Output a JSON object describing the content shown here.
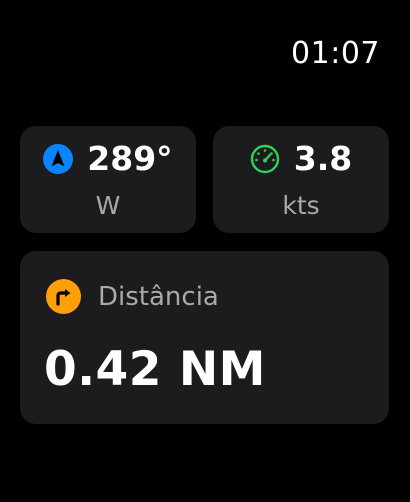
{
  "status_bar": {
    "time": "01:07"
  },
  "heading_card": {
    "icon": "navigation-arrow-icon",
    "icon_color": "#0a84ff",
    "value": "289°",
    "direction": "W"
  },
  "speed_card": {
    "icon": "speedometer-icon",
    "icon_color": "#30d158",
    "value": "3.8",
    "unit": "kts"
  },
  "distance_card": {
    "icon": "turn-right-arrow-icon",
    "icon_color": "#ff9f0a",
    "label": "Distância",
    "value": "0.42 NM"
  }
}
